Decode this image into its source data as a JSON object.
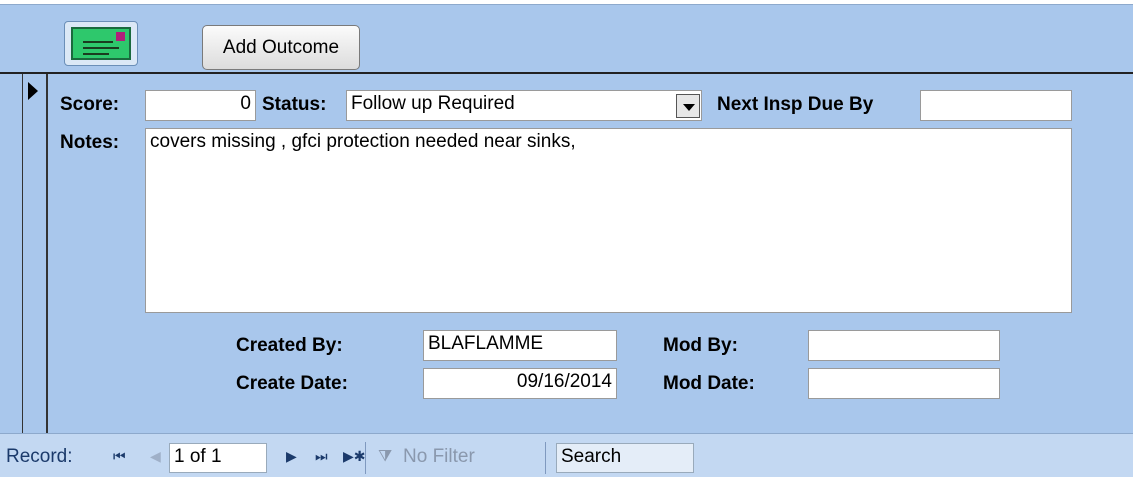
{
  "header": {
    "icon_name": "envelope-icon",
    "add_outcome_label": "Add Outcome"
  },
  "detail": {
    "score_label": "Score:",
    "score_value": "0",
    "status_label": "Status:",
    "status_value": "Follow up Required",
    "next_insp_label": "Next Insp Due By",
    "next_insp_value": "",
    "notes_label": "Notes:",
    "notes_value": "covers missing , gfci protection needed near sinks,",
    "created_by_label": "Created By:",
    "created_by_value": "BLAFLAMME",
    "create_date_label": "Create Date:",
    "create_date_value": "09/16/2014",
    "mod_by_label": "Mod By:",
    "mod_by_value": "",
    "mod_date_label": "Mod Date:",
    "mod_date_value": ""
  },
  "navigation": {
    "record_label": "Record:",
    "record_position": "1 of 1",
    "filter_label": "No Filter",
    "search_label": "Search",
    "first_icon": "⏮",
    "prev_icon": "◀",
    "next_icon": "▶",
    "last_icon": "⏭",
    "new_icon": "▶✱"
  },
  "colors": {
    "form_background": "#a9c7ec",
    "nav_background": "#c3d8f2",
    "icon_green": "#2ec86c"
  }
}
